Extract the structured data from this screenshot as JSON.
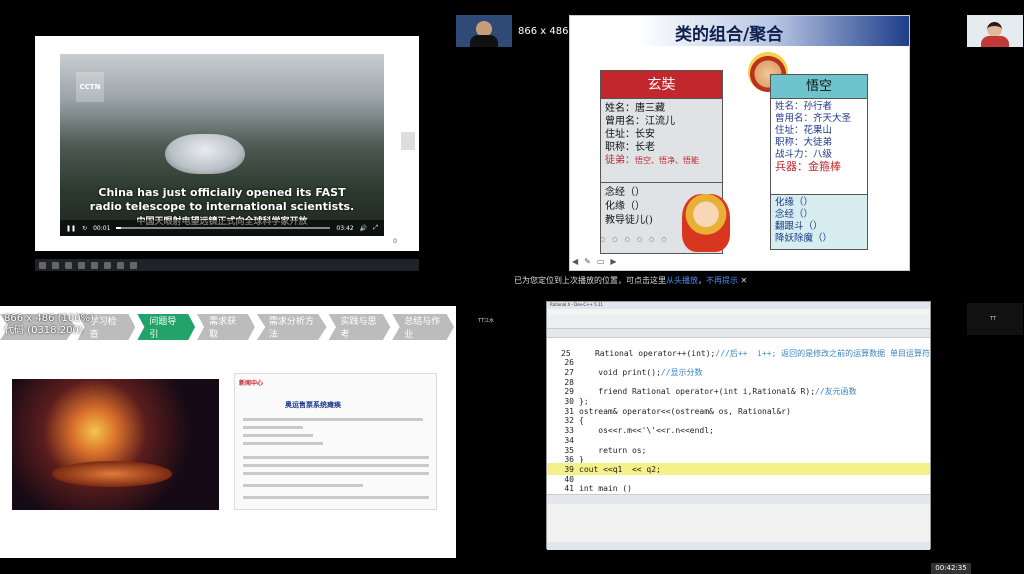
{
  "q1": {
    "logo": "CCTN",
    "subtitle_line1": "China has just officially opened its FAST",
    "subtitle_line2": "radio telescope to international scientists.",
    "subtitle_zh": "中国天眼射电望远镜正式向全球科学家开放",
    "time_current": "00:01",
    "time_end": "03:42",
    "progress_fraction": 0.02,
    "page_number": "0"
  },
  "share_label": "866 x 486 (68%)",
  "q2": {
    "title": "类的组合/聚合",
    "xuanzang": {
      "name": "玄奘",
      "attrs": [
        "姓名：唐三藏",
        "曾用名：江流儿",
        "住址：长安",
        "职称：长老"
      ],
      "disciples_label": "徒弟：",
      "disciples": "悟空、悟净、悟能",
      "methods": [
        "念经（）",
        "化缘（）",
        "教导徒儿()"
      ]
    },
    "wukong": {
      "name": "悟空",
      "attrs": [
        "姓名：孙行者",
        "曾用名：齐天大圣",
        "住址：花果山",
        "职称：大徒弟",
        "战斗力：八级"
      ],
      "weapon": "兵器：金箍棒",
      "methods": [
        "化缘（）",
        "念经（）",
        "翻跟斗（）",
        "降妖除魔（）"
      ]
    }
  },
  "resume_bar": {
    "text": "已为您定位到上次播放的位置，可点击这里",
    "link1": "从头播放",
    "link2": "不再提示"
  },
  "q3": {
    "overlay_line1": "866 x 486 (100%)",
    "overlay_line2": "代码 (0318.200)",
    "nav": [
      "学习检查",
      "问题导引",
      "需求获取",
      "需求分析方法",
      "实践与思考",
      "总结与作业"
    ],
    "active_nav": 1,
    "news_logo": "新闻中心",
    "news_title": "奥运售票系统瘫痪"
  },
  "q3_side_label": "TT江水",
  "q4": {
    "title_bar": "Rational.h - Dev-C++ 5.11",
    "lines": [
      {
        "n": "25",
        "code": "    Rational operator++(int);///后++  i++; 返回的是修改之前的运算数据 单目运算符"
      },
      {
        "n": "26",
        "code": ""
      },
      {
        "n": "27",
        "code": "    void print();//显示分数"
      },
      {
        "n": "28",
        "code": ""
      },
      {
        "n": "29",
        "code": "    friend Rational operator+(int i,Rational& R);//友元函数"
      },
      {
        "n": "30",
        "code": "};"
      },
      {
        "n": "31",
        "code": "ostream& operator<<(ostream& os, Rational&r)"
      },
      {
        "n": "32",
        "code": "{"
      },
      {
        "n": "33",
        "code": "    os<<r.m<<'\\'<<r.n<<endl;"
      },
      {
        "n": "34",
        "code": ""
      },
      {
        "n": "35",
        "code": "    return os;"
      },
      {
        "n": "36",
        "code": "}"
      },
      {
        "n": "39",
        "code": "cout <<q1  << q2;"
      },
      {
        "n": "40",
        "code": ""
      },
      {
        "n": "41",
        "code": "int main ()"
      }
    ]
  },
  "q4_side_label": "TT",
  "timer": "00:42:35"
}
